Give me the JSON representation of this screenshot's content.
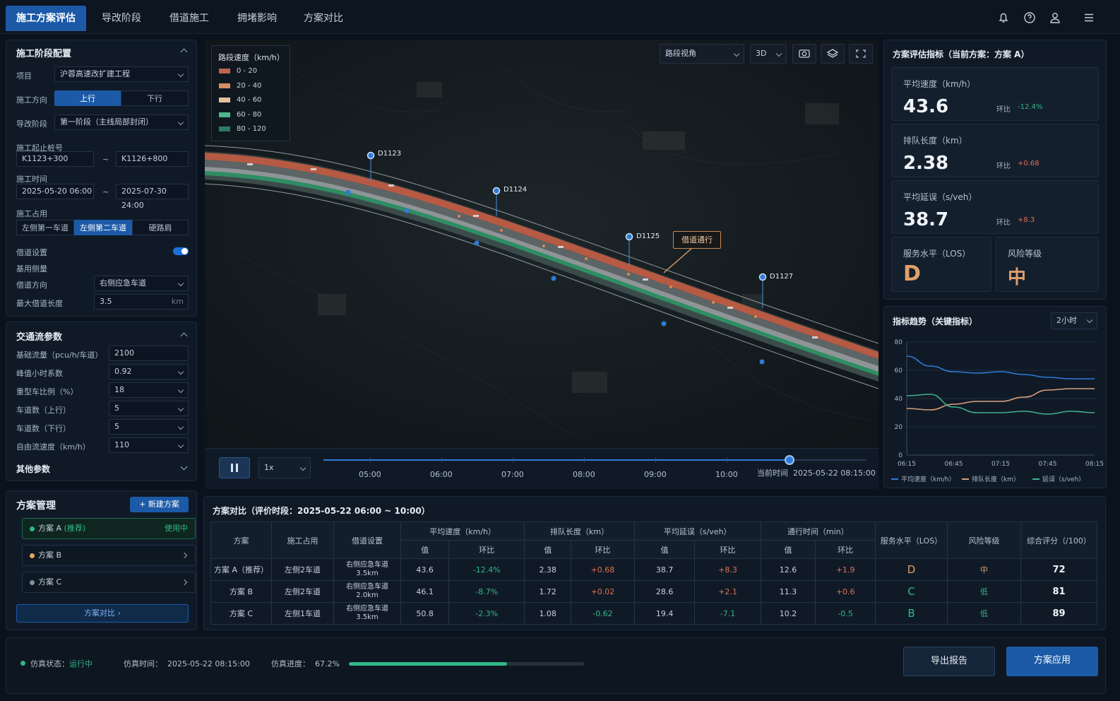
{
  "nav": {
    "tabs": [
      "施工方案评估",
      "导改阶段",
      "借道施工",
      "拥堵影响",
      "方案对比"
    ]
  },
  "config": {
    "title": "施工阶段配置",
    "project_label": "项目",
    "project_value": "沪蓉高速改扩建工程",
    "direction_label": "施工方向",
    "direction_opts": [
      "上行",
      "下行"
    ],
    "stage_label": "导改阶段",
    "stage_value": "第一阶段（主线局部封闭）",
    "range_label": "施工起止桩号",
    "range_from": "K1123+300",
    "range_to": "K1126+800",
    "tilde": "~",
    "time_label": "施工时间",
    "time_from": "2025-05-20 06:00",
    "time_to": "2025-07-30 24:00",
    "occupy_label": "施工占用",
    "occupy_opts": [
      "左侧第一车道",
      "左侧第二车道",
      "硬路肩"
    ],
    "borrow_label": "借道设置",
    "borrow_lane_label": "基用侧量",
    "borrow_dir_label": "借道方向",
    "borrow_dir_value": "右侧应急车道",
    "maxlen_label": "最大借道长度",
    "maxlen_value": "3.5",
    "maxlen_unit": "km"
  },
  "traffic": {
    "title": "交通流参数",
    "rows": [
      {
        "label": "基础流量（pcu/h/车道）",
        "value": "2100"
      },
      {
        "label": "峰值小时系数",
        "value": "0.92"
      },
      {
        "label": "重型车比例（%）",
        "value": "18"
      },
      {
        "label": "车道数（上行）",
        "value": "5"
      },
      {
        "label": "车道数（下行）",
        "value": "5"
      },
      {
        "label": "自由流速度（km/h）",
        "value": "110"
      }
    ],
    "other": "其他参数"
  },
  "scenarios": {
    "title": "方案管理",
    "new_btn": "+ 新建方案",
    "items": [
      {
        "name": "方案 A",
        "tag": "(推荐)",
        "status": "使用中",
        "color": "#2fb886"
      },
      {
        "name": "方案 B",
        "color": "#e0a95a"
      },
      {
        "name": "方案 C",
        "color": "#7c8ea3"
      }
    ],
    "compare_btn": "方案对比"
  },
  "map": {
    "legend_title": "路段速度（km/h）",
    "legend": [
      {
        "label": "0 - 20",
        "color": "#c0654d"
      },
      {
        "label": "20 - 40",
        "color": "#d88e62"
      },
      {
        "label": "40 - 60",
        "color": "#e3c199"
      },
      {
        "label": "60 - 80",
        "color": "#4fb58a"
      },
      {
        "label": "80 - 120",
        "color": "#2e7a62"
      }
    ],
    "view_select": "路段视角",
    "mode_select": "3D",
    "markers": [
      "D1123",
      "D1124",
      "D1125",
      "D1127"
    ],
    "callout": "借道通行"
  },
  "timeline": {
    "speed": "1x",
    "ticks": [
      "05:00",
      "06:00",
      "07:00",
      "08:00",
      "09:00",
      "10:00"
    ],
    "current_label": "当前时间",
    "current_value": "2025-05-22 08:15:00",
    "progress": 0.86
  },
  "kpi": {
    "title": "方案评估指标（当前方案：方案 A）",
    "cards": [
      {
        "title": "平均速度（km/h）",
        "value": "43.6",
        "cmp": "环比",
        "delta": "-12.4%",
        "color": "#2fb886"
      },
      {
        "title": "排队长度（km）",
        "value": "2.38",
        "cmp": "环比",
        "delta": "+0.68",
        "color": "#e0704f"
      },
      {
        "title": "平均延误（s/veh）",
        "value": "38.7",
        "cmp": "环比",
        "delta": "+8.3",
        "color": "#e0704f"
      }
    ],
    "los_title": "服务水平（LOS）",
    "los_value": "D",
    "risk_title": "风险等级",
    "risk_value": "中"
  },
  "trend": {
    "title": "指标趋势（关键指标）",
    "interval": "2小时",
    "yticks": [
      "80",
      "60",
      "40",
      "20",
      "0"
    ],
    "xticks": [
      "06:15",
      "06:45",
      "07:15",
      "07:45",
      "08:15"
    ],
    "legend": [
      "平均速度（km/h）",
      "排队长度（km）",
      "延误（s/veh）"
    ],
    "colors": [
      "#2f7bd8",
      "#d9a07a",
      "#3fb08c"
    ]
  },
  "chart_data": {
    "type": "line",
    "x": [
      "06:15",
      "06:30",
      "06:45",
      "07:00",
      "07:15",
      "07:30",
      "07:45",
      "08:00",
      "08:15"
    ],
    "ylim": [
      0,
      80
    ],
    "series": [
      {
        "name": "平均速度（km/h）",
        "values": [
          70,
          63,
          59,
          58,
          59,
          57,
          55,
          54,
          54
        ]
      },
      {
        "name": "排队长度（km）",
        "values": [
          33,
          32,
          36,
          38,
          38,
          41,
          46,
          47,
          47
        ]
      },
      {
        "name": "延误（s/veh）",
        "values": [
          42,
          43,
          34,
          30,
          30,
          31,
          29,
          31,
          30
        ]
      }
    ]
  },
  "compare": {
    "title": "方案对比（评价时段：2025-05-22 06:00 ~ 10:00）",
    "h_scheme": "方案",
    "h_occupy": "施工占用",
    "h_borrow": "借道设置",
    "h_speed": "平均速度（km/h）",
    "h_queue": "排队长度（km）",
    "h_delay": "平均延误（s/veh）",
    "h_time": "通行时间（min）",
    "h_los": "服务水平（LOS）",
    "h_risk": "风险等级",
    "h_score": "综合评分（/100）",
    "h_val": "值",
    "h_cmp": "环比",
    "rows": [
      {
        "name": "方案 A（推荐）",
        "occupy": "左侧2车道",
        "borrow": "右侧应急车道 3.5km",
        "speed": "43.6",
        "speed_d": "-12.4%",
        "queue": "2.38",
        "queue_d": "+0.68",
        "delay": "38.7",
        "delay_d": "+8.3",
        "time": "12.6",
        "time_d": "+1.9",
        "los": "D",
        "risk": "中",
        "score": "72"
      },
      {
        "name": "方案 B",
        "occupy": "左侧2车道",
        "borrow": "右侧应急车道 2.0km",
        "speed": "46.1",
        "speed_d": "-8.7%",
        "queue": "1.72",
        "queue_d": "+0.02",
        "delay": "28.6",
        "delay_d": "+2.1",
        "time": "11.3",
        "time_d": "+0.6",
        "los": "C",
        "risk": "低",
        "score": "81"
      },
      {
        "name": "方案 C",
        "occupy": "左侧1车道",
        "borrow": "右侧应急车道 3.5km",
        "speed": "50.8",
        "speed_d": "-2.3%",
        "queue": "1.08",
        "queue_d": "-0.62",
        "delay": "19.4",
        "delay_d": "-7.1",
        "time": "10.2",
        "time_d": "-0.5",
        "los": "B",
        "risk": "低",
        "score": "89"
      }
    ]
  },
  "status": {
    "state_label": "仿真状态：",
    "state_value": "运行中",
    "time_label": "仿真时间：",
    "time_value": "2025-05-22 08:15:00",
    "progress_label": "仿真进度：",
    "progress_value": "67.2%",
    "progress": 0.672,
    "export_btn": "导出报告",
    "apply_btn": "方案应用"
  }
}
